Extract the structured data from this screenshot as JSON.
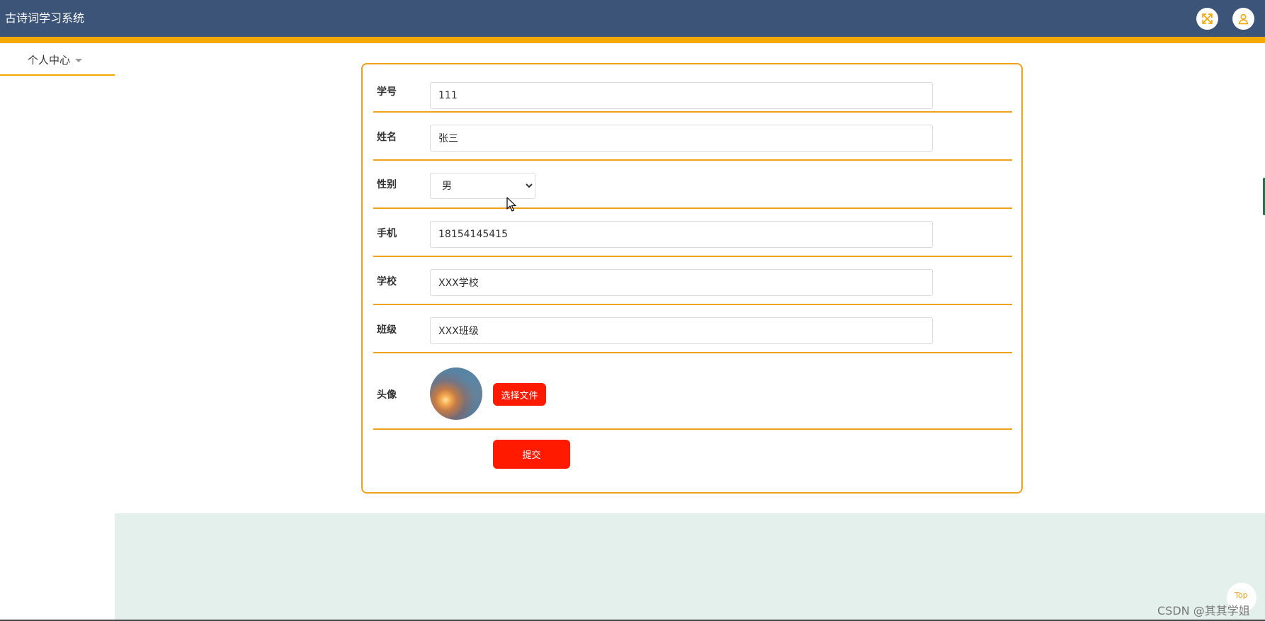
{
  "header": {
    "title": "古诗词学习系统"
  },
  "sidebar": {
    "menu_label": "个人中心"
  },
  "form": {
    "fields": [
      {
        "label": "学号",
        "value": "111"
      },
      {
        "label": "姓名",
        "value": "张三"
      },
      {
        "label": "性别",
        "value": "男"
      },
      {
        "label": "手机",
        "value": "18154145415"
      },
      {
        "label": "学校",
        "value": "XXX学校"
      },
      {
        "label": "班级",
        "value": "XXX班级"
      },
      {
        "label": "头像"
      }
    ],
    "gender_options": [
      "男"
    ],
    "choose_file_label": "选择文件",
    "submit_label": "提交"
  },
  "footer": {
    "top_label": "Top",
    "watermark": "CSDN @其其学姐"
  },
  "colors": {
    "header_bg": "#3c5478",
    "accent": "#f5a800",
    "button_red": "#ff1a00",
    "footer_bg": "#e4f0ec"
  }
}
